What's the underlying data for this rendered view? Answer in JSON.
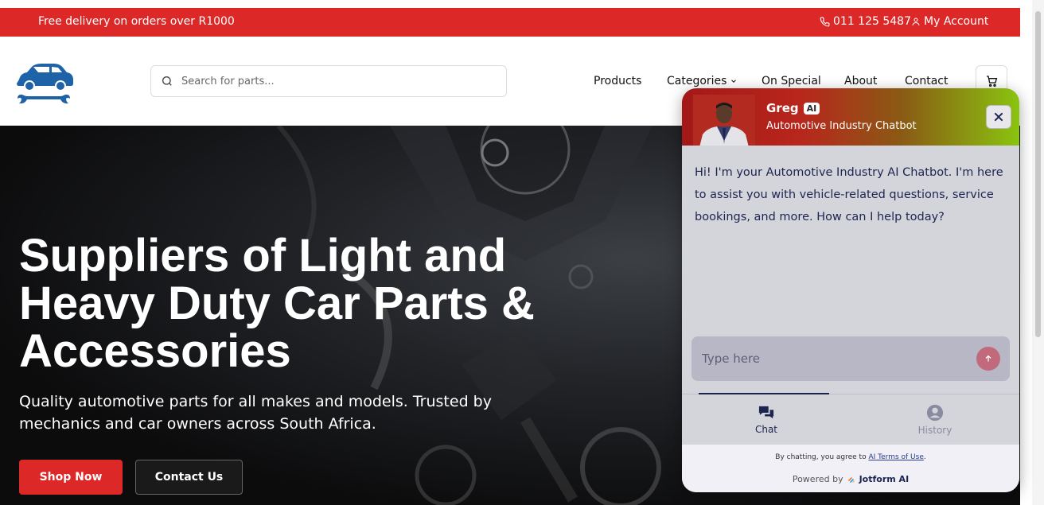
{
  "topbar": {
    "promo": "Free delivery on orders over R1000",
    "phone": "011 125 5487",
    "account": "My Account"
  },
  "header": {
    "search_placeholder": "Search for parts...",
    "nav": [
      "Products",
      "Categories",
      "On Special",
      "About",
      "Contact"
    ]
  },
  "hero": {
    "title": "Suppliers of Light and Heavy Duty Car Parts & Accessories",
    "subtitle": "Quality automotive parts for all makes and models. Trusted by mechanics and car owners across South Africa.",
    "shop_label": "Shop Now",
    "contact_label": "Contact Us"
  },
  "chat": {
    "name": "Greg",
    "badge": "AI",
    "role": "Automotive Industry Chatbot",
    "message": "Hi! I'm your Automotive Industry AI Chatbot. I'm here to assist you with vehicle-related questions, service bookings, and more. How can I help today?",
    "input_placeholder": "Type here",
    "tabs": [
      "Chat",
      "History"
    ],
    "terms_prefix": "By chatting, you agree to",
    "terms_link": "AI Terms of Use",
    "terms_suffix": ".",
    "powered_by": "Powered by",
    "brand": "Jotform AI"
  },
  "colors": {
    "brand_red": "#dd2828",
    "logo_blue": "#1e63a8",
    "chat_text": "#1c2450"
  }
}
